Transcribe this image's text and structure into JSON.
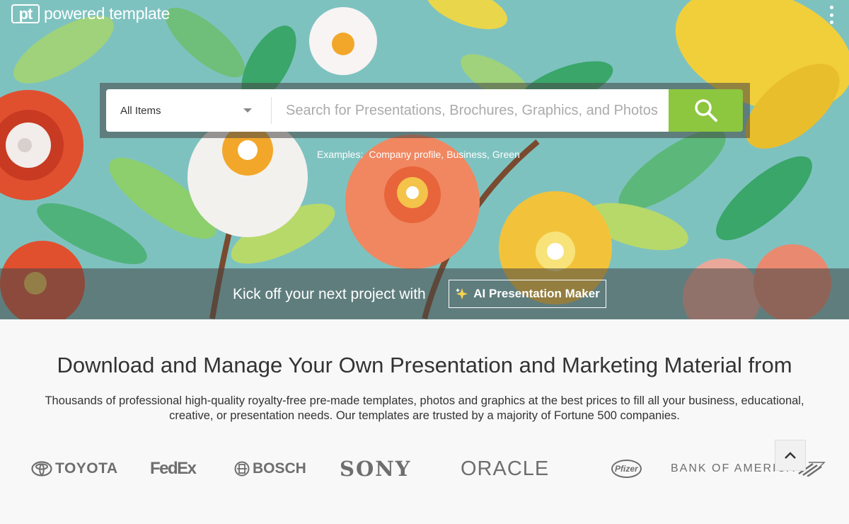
{
  "header": {
    "logo_mark": "pt",
    "logo_name": "powered template"
  },
  "search": {
    "category_value": "All Items",
    "placeholder": "Search for Presentations, Brochures, Graphics, and Photos",
    "examples_label": "Examples:",
    "examples": [
      "Company profile,",
      "Business,",
      "Green"
    ]
  },
  "promo": {
    "text": "Kick off your next project with",
    "button_label": "AI Presentation Maker"
  },
  "main": {
    "headline": "Download and Manage Your Own Presentation and Marketing Material from",
    "subtext": "Thousands of professional high-quality royalty-free pre-made templates, photos and graphics at the best prices to fill all your business, educational, creative, or presentation needs. Our templates are trusted by a majority of Fortune 500 companies."
  },
  "brands": {
    "toyota": "TOYOTA",
    "fedex": "FedEx",
    "bosch": "BOSCH",
    "sony": "SONY",
    "oracle": "ORACLE",
    "pfizer": "Pfizer",
    "bofa": "BANK OF AMERICA"
  },
  "colors": {
    "accent_green": "#8dc63f",
    "hero_bg": "#7cc3c0",
    "text": "#333333"
  },
  "icons": {
    "search": "search-icon",
    "menu": "kebab-menu-icon",
    "sparkle": "sparkle-icon",
    "back_to_top": "chevron-up-icon"
  }
}
